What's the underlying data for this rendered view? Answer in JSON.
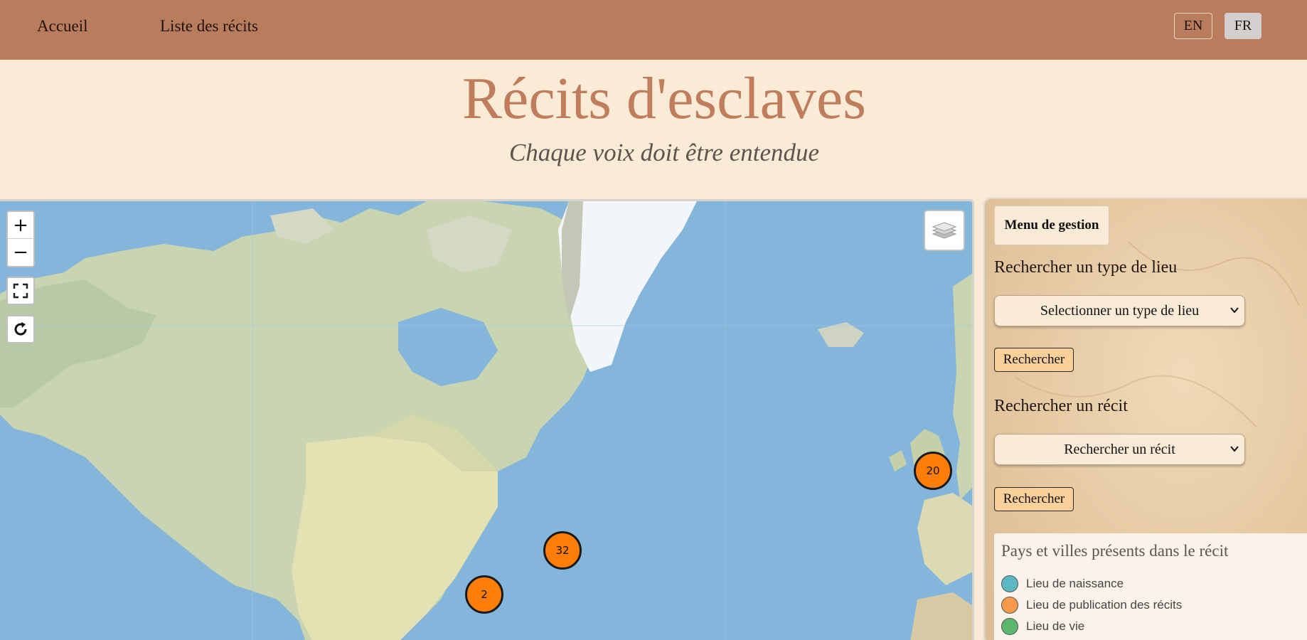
{
  "nav": {
    "home": "Accueil",
    "list": "Liste des récits",
    "lang_en": "EN",
    "lang_fr": "FR",
    "active_lang": "FR"
  },
  "hero": {
    "title": "Récits d'esclaves",
    "subtitle": "Chaque voix doit être entendue"
  },
  "map": {
    "zoom_in": "+",
    "zoom_out": "−",
    "clusters": [
      {
        "count": "20",
        "region": "Royaume-Uni"
      },
      {
        "count": "32",
        "region": "Nord-Est des États-Unis"
      },
      {
        "count": "2",
        "region": "Sud des États-Unis"
      }
    ],
    "cluster_color": "#ff7e0a"
  },
  "panel": {
    "management_button": "Menu de gestion",
    "place_type_heading": "Rechercher un type de lieu",
    "place_type_select": "Selectionner un type de lieu",
    "place_type_search": "Rechercher",
    "recit_heading": "Rechercher un récit",
    "recit_select": "Rechercher un récit",
    "recit_search": "Rechercher",
    "legend": {
      "title": "Pays et villes présents dans le récit",
      "items": [
        {
          "label": "Lieu de naissance",
          "color": "#5ab9c4"
        },
        {
          "label": "Lieu de publication des récits",
          "color": "#f79a4e"
        },
        {
          "label": "Lieu de vie",
          "color": "#5cb76a"
        }
      ]
    }
  },
  "colors": {
    "navbar": "#b97d5e",
    "background": "#faebd7",
    "title": "#c07d5c",
    "button": "#f9cf9a"
  }
}
